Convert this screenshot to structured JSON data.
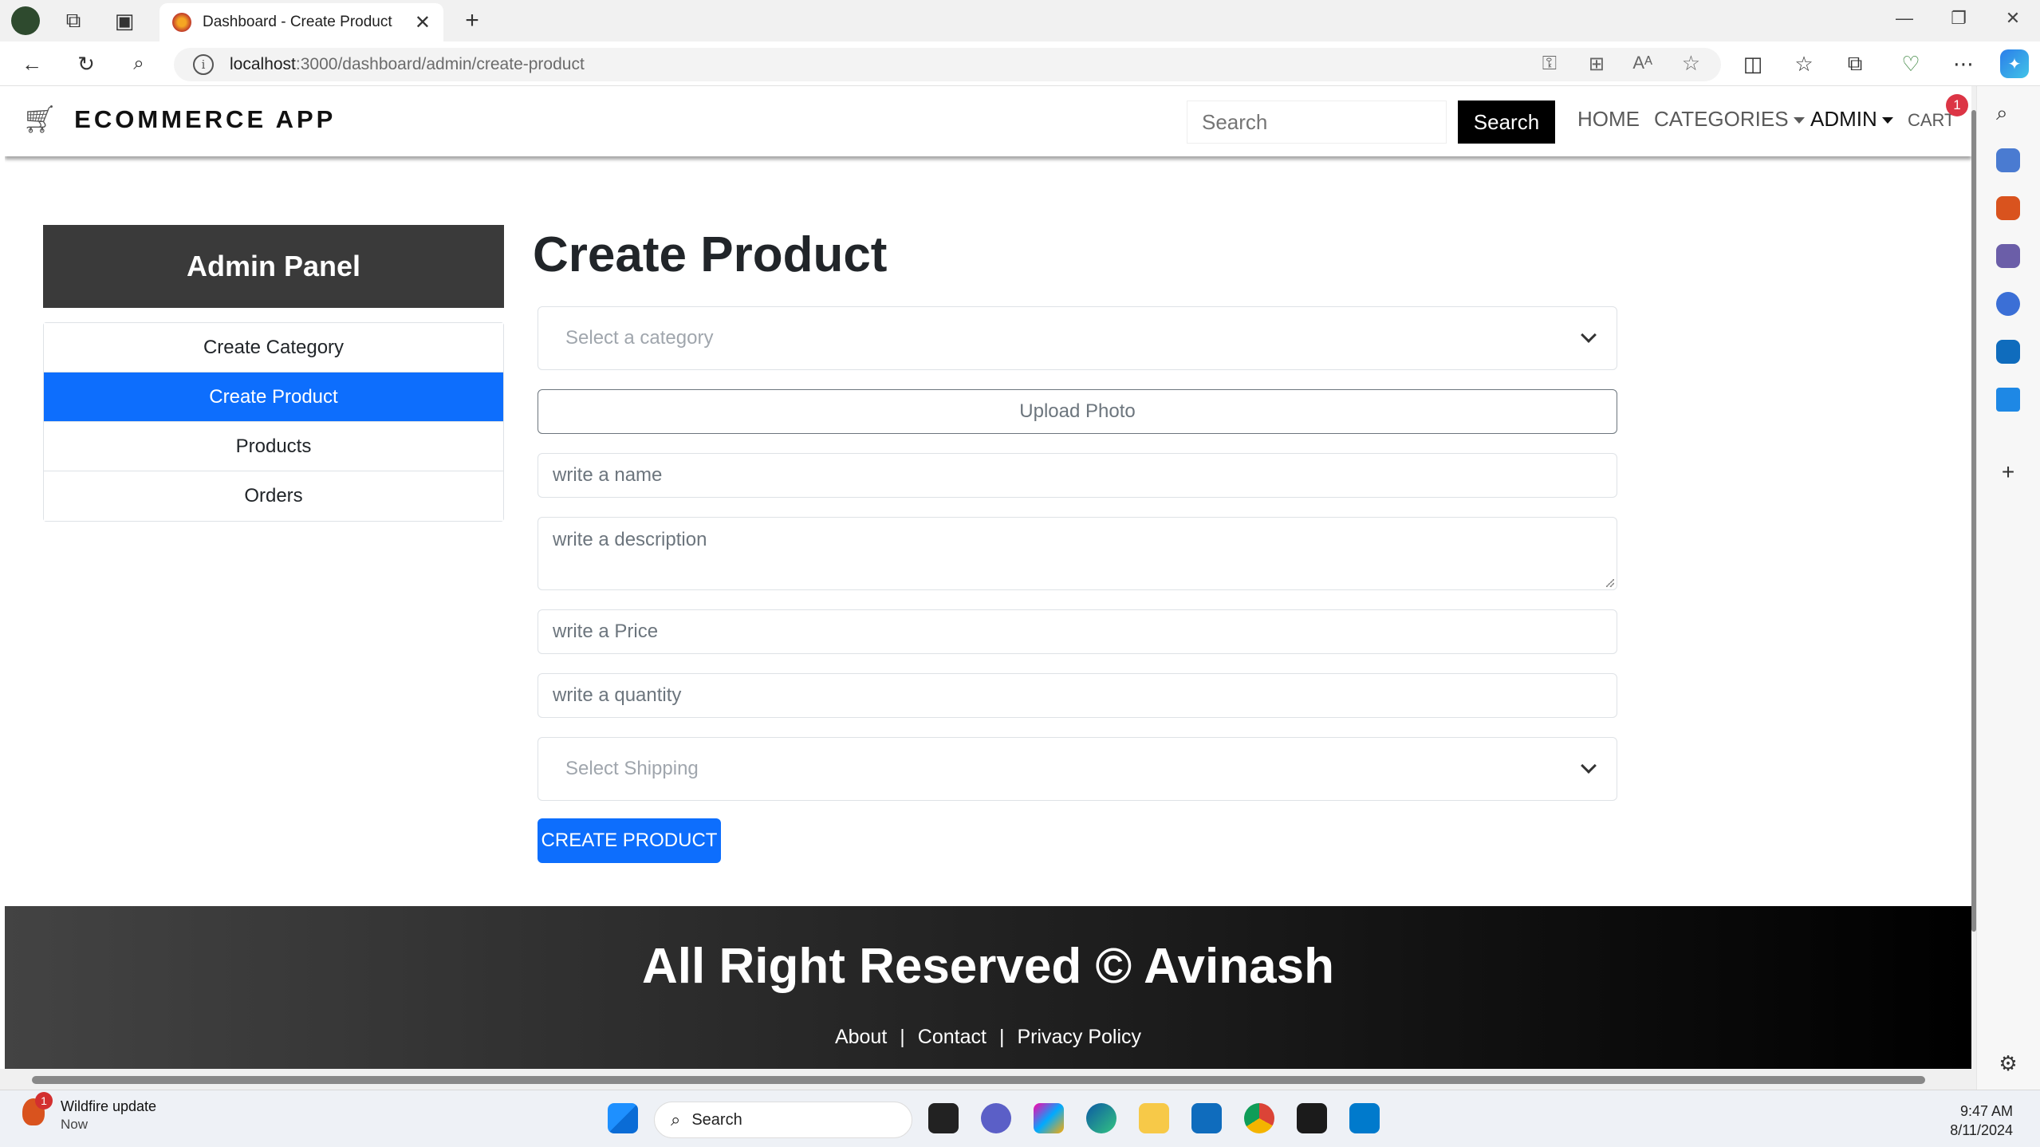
{
  "browser": {
    "tab_title": "Dashboard - Create Product",
    "url_host": "localhost",
    "url_path": ":3000/dashboard/admin/create-product"
  },
  "header": {
    "brand": "ECOMMERCE APP",
    "search_placeholder": "Search",
    "search_button": "Search",
    "nav": {
      "home": "HOME",
      "categories": "CATEGORIES",
      "admin": "ADMIN",
      "cart": "CART",
      "cart_count": "1"
    }
  },
  "admin_panel": {
    "title": "Admin Panel",
    "menu": [
      {
        "label": "Create Category"
      },
      {
        "label": "Create Product"
      },
      {
        "label": "Products"
      },
      {
        "label": "Orders"
      }
    ]
  },
  "form": {
    "heading": "Create Product",
    "category_placeholder": "Select a category",
    "upload_label": "Upload Photo",
    "name_placeholder": "write a name",
    "description_placeholder": "write a description",
    "price_placeholder": "write a Price",
    "quantity_placeholder": "write a quantity",
    "shipping_placeholder": "Select Shipping",
    "submit_label": "CREATE PRODUCT"
  },
  "footer": {
    "title": "All Right Reserved © Avinash",
    "links": {
      "about": "About",
      "sep1": "|",
      "contact": "Contact",
      "sep2": "|",
      "privacy": "Privacy Policy"
    }
  },
  "taskbar": {
    "notification_title": "Wildfire update",
    "notification_time": "Now",
    "notification_count": "1",
    "search_label": "Search",
    "time": "9:47 AM",
    "date": "8/11/2024"
  },
  "colors": {
    "primary": "#0d6efd",
    "panel_header": "#3a3a3a",
    "badge": "#dc3545"
  }
}
